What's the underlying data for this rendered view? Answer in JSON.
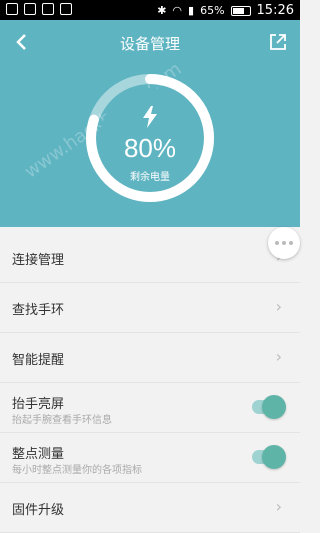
{
  "status_bar": {
    "battery": "65%",
    "time": "15:26"
  },
  "header": {
    "title": "设备管理"
  },
  "battery": {
    "percent_text": "80%",
    "label": "剩余电量",
    "level": 0.8
  },
  "list": {
    "items": [
      {
        "label": "连接管理"
      },
      {
        "label": "查找手环"
      },
      {
        "label": "智能提醒"
      },
      {
        "label": "抬手亮屏",
        "sub": "抬起手腕查看手环信息",
        "toggle": "on"
      },
      {
        "label": "整点测量",
        "sub": "每小时整点测量你的各项指标",
        "toggle": "on"
      },
      {
        "label": "固件升级"
      }
    ]
  },
  "icons": {
    "back": "back-arrow-icon",
    "share": "share-icon",
    "bolt": "lightning-icon",
    "more": "more-dots-icon",
    "chevron": "chevron-right-icon"
  },
  "colors": {
    "accent": "#5fb4c2",
    "toggle_on": "#5fb4a8"
  },
  "watermark": "www.hackhome.com"
}
